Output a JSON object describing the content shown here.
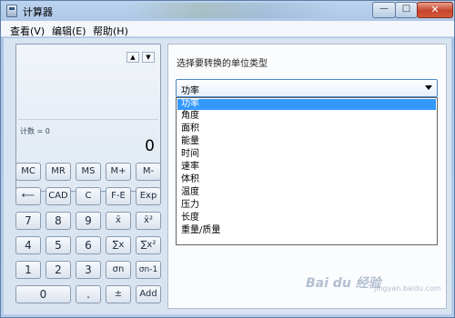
{
  "window": {
    "title": "计算器",
    "minimize": "—",
    "maximize": "□",
    "close": "✕"
  },
  "menu": {
    "items": [
      "查看(V)",
      "编辑(E)",
      "帮助(H)"
    ]
  },
  "display": {
    "history_up": "▲",
    "history_down": "▼",
    "count_label": "计数 = 0",
    "value": "0"
  },
  "keys": {
    "row1": [
      "MC",
      "MR",
      "MS",
      "M+",
      "M-"
    ],
    "row2": [
      "⟵",
      "CAD",
      "C",
      "F-E",
      "Exp"
    ],
    "row3": [
      "7",
      "8",
      "9",
      "x̄",
      "x̄²"
    ],
    "row4": [
      "4",
      "5",
      "6",
      "∑x",
      "∑x²"
    ],
    "row5": [
      "1",
      "2",
      "3",
      "σn",
      "σn-1"
    ],
    "row6": [
      "0",
      ".",
      "±",
      "Add"
    ]
  },
  "converter": {
    "prompt": "选择要转换的单位类型",
    "selected": "功率",
    "options": [
      "功率",
      "角度",
      "面积",
      "能量",
      "时间",
      "速率",
      "体积",
      "温度",
      "压力",
      "长度",
      "重量/质量"
    ]
  },
  "watermark": {
    "text": "Bai du 经验",
    "sub": "jingyan.baidu.com"
  }
}
